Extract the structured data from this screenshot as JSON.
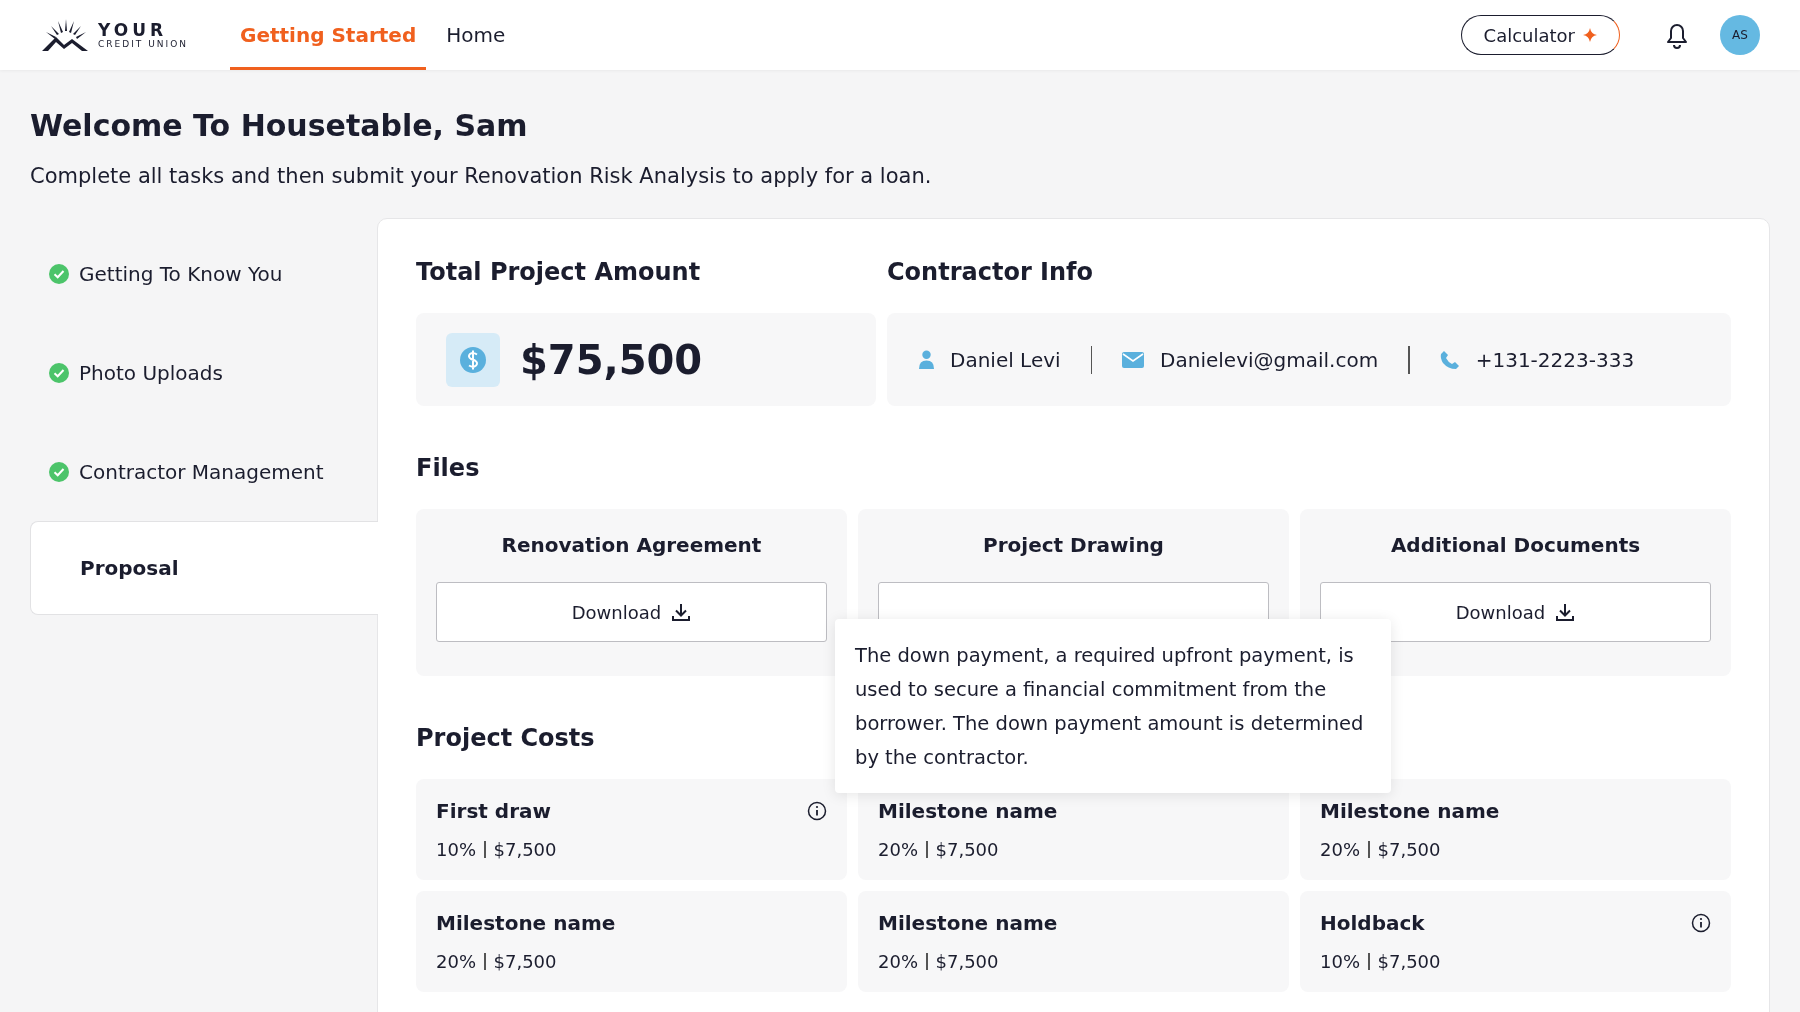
{
  "brand": {
    "name": "YOUR",
    "subtitle": "CREDIT UNION"
  },
  "nav": [
    {
      "label": "Getting Started",
      "selected": true
    },
    {
      "label": "Home",
      "selected": false
    }
  ],
  "header": {
    "calculator_label": "Calculator",
    "avatar_initials": "AS"
  },
  "welcome": {
    "title": "Welcome To Housetable, Sam",
    "subtitle": "Complete all tasks and then submit your Renovation Risk Analysis to apply for a loan."
  },
  "sidebar": {
    "items": [
      {
        "label": "Getting To Know You",
        "completed": true,
        "selected": false
      },
      {
        "label": "Photo Uploads",
        "completed": true,
        "selected": false
      },
      {
        "label": "Contractor Management",
        "completed": true,
        "selected": false
      },
      {
        "label": "Proposal",
        "completed": false,
        "selected": true
      }
    ]
  },
  "total_project_amount": {
    "heading": "Total Project Amount",
    "amount": "$75,500"
  },
  "contractor_info": {
    "heading": "Contractor Info",
    "name": "Daniel Levi",
    "email": "Danielevi@gmail.com",
    "phone": "+131-2223-333"
  },
  "files": {
    "heading": "Files",
    "items": [
      {
        "title": "Renovation Agreement",
        "download_label": "Download"
      },
      {
        "title": "Project Drawing"
      },
      {
        "title": "Additional Documents",
        "download_label": "Download"
      }
    ]
  },
  "project_costs": {
    "heading": "Project Costs",
    "items": [
      {
        "name": "First draw",
        "share": "10%",
        "amount": "$7,500",
        "info": true
      },
      {
        "name": "Milestone name",
        "share": "20%",
        "amount": "$7,500",
        "info": false
      },
      {
        "name": "Milestone name",
        "share": "20%",
        "amount": "$7,500",
        "info": false
      },
      {
        "name": "Milestone name",
        "share": "20%",
        "amount": "$7,500",
        "info": false
      },
      {
        "name": "Milestone name",
        "share": "20%",
        "amount": "$7,500",
        "info": false
      },
      {
        "name": "Holdback",
        "share": "10%",
        "amount": "$7,500",
        "info": true
      }
    ]
  },
  "tooltip": {
    "text": "The down payment, a required upfront payment, is used to secure a financial commitment from the borrower. The down payment amount is determined by the contractor."
  }
}
